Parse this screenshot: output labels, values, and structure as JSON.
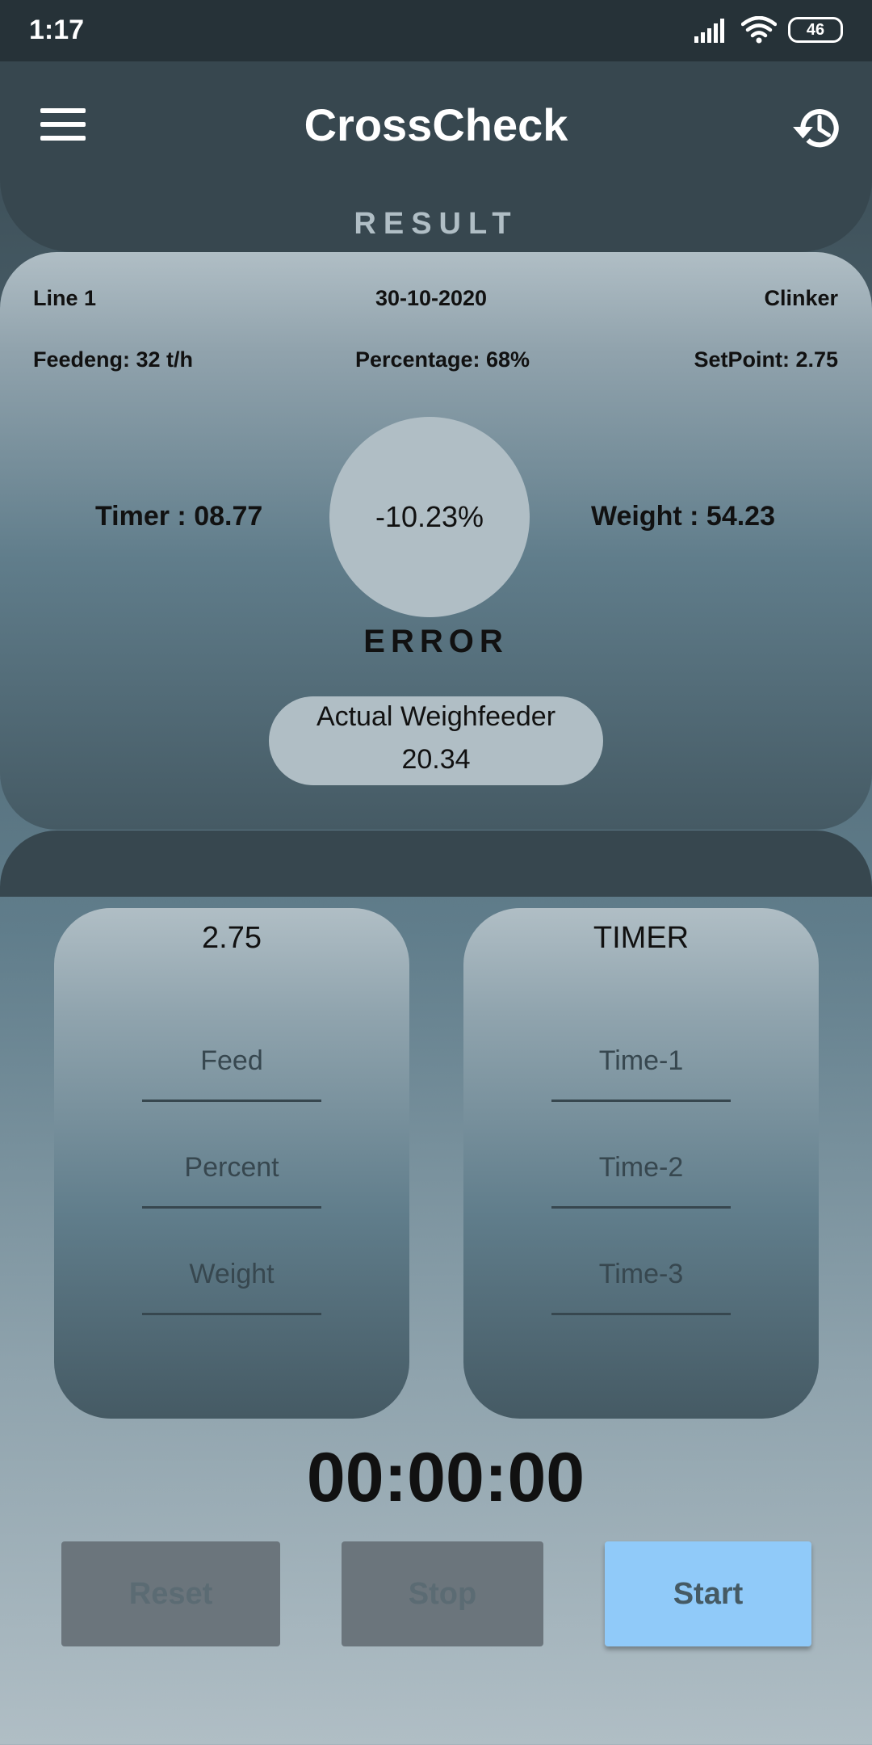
{
  "status_bar": {
    "time": "1:17",
    "battery": "46"
  },
  "app_bar": {
    "title": "CrossCheck",
    "section_label": "RESULT"
  },
  "result": {
    "line": "Line 1",
    "date": "30-10-2020",
    "material": "Clinker",
    "feeding": "Feedeng: 32 t/h",
    "percentage": "Percentage: 68%",
    "setpoint": "SetPoint: 2.75",
    "timer": "Timer : 08.77",
    "error_value": "-10.23%",
    "weight": "Weight : 54.23",
    "error_label": "ERROR",
    "weighfeeder_label": "Actual Weighfeeder",
    "weighfeeder_value": "20.34"
  },
  "setpoint_panel": {
    "title": "2.75",
    "fields": [
      {
        "placeholder": "Feed"
      },
      {
        "placeholder": "Percent"
      },
      {
        "placeholder": "Weight"
      }
    ]
  },
  "timer_panel": {
    "title": "TIMER",
    "fields": [
      {
        "placeholder": "Time-1"
      },
      {
        "placeholder": "Time-2"
      },
      {
        "placeholder": "Time-3"
      }
    ]
  },
  "stopwatch": {
    "display": "00:00:00"
  },
  "buttons": {
    "reset": "Reset",
    "stop": "Stop",
    "start": "Start"
  },
  "colors": {
    "accent": "#90caf9",
    "primary_dark": "#37474f",
    "surface_light": "#b0bec5"
  },
  "icons": {
    "menu": "menu-icon",
    "history": "history-icon"
  }
}
